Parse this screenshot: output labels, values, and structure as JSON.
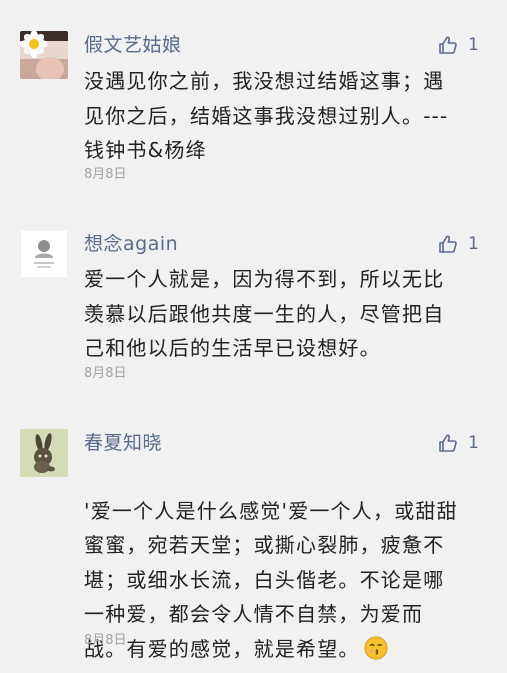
{
  "comments": [
    {
      "user": "假文艺姑娘",
      "likes": "1",
      "text": "没遇见你之前，我没想过结婚这事；遇\n见你之后，结婚这事我没想过别人。---\n钱钟书&杨绛",
      "date": "8月8日",
      "avatar_icon": "flower-avatar-icon"
    },
    {
      "user": "想念again",
      "likes": "1",
      "text": "爱一个人就是，因为得不到，所以无比\n羡慕以后跟他共度一生的人，尽管把自\n己和他以后的生活早已设想好。",
      "date": "8月8日",
      "avatar_icon": "white-profile-avatar-icon"
    },
    {
      "user": "春夏知晓",
      "likes": "1",
      "text": "'爱一个人是什么感觉'爱一个人，或甜甜\n蜜蜜，宛若天堂；或撕心裂肺，疲惫不\n堪；或细水长流，白头偕老。不论是哪\n一种爱，都会令人情不自禁，为爱而\n战。有爱的感觉，就是希望。",
      "date": "8月8日",
      "avatar_icon": "rabbit-avatar-icon",
      "emoji": "kissing-face-emoji"
    }
  ],
  "colors": {
    "background": "#f1f1f1",
    "name": "#5b6b8c",
    "text": "#222222",
    "date": "#a3a3a3"
  }
}
